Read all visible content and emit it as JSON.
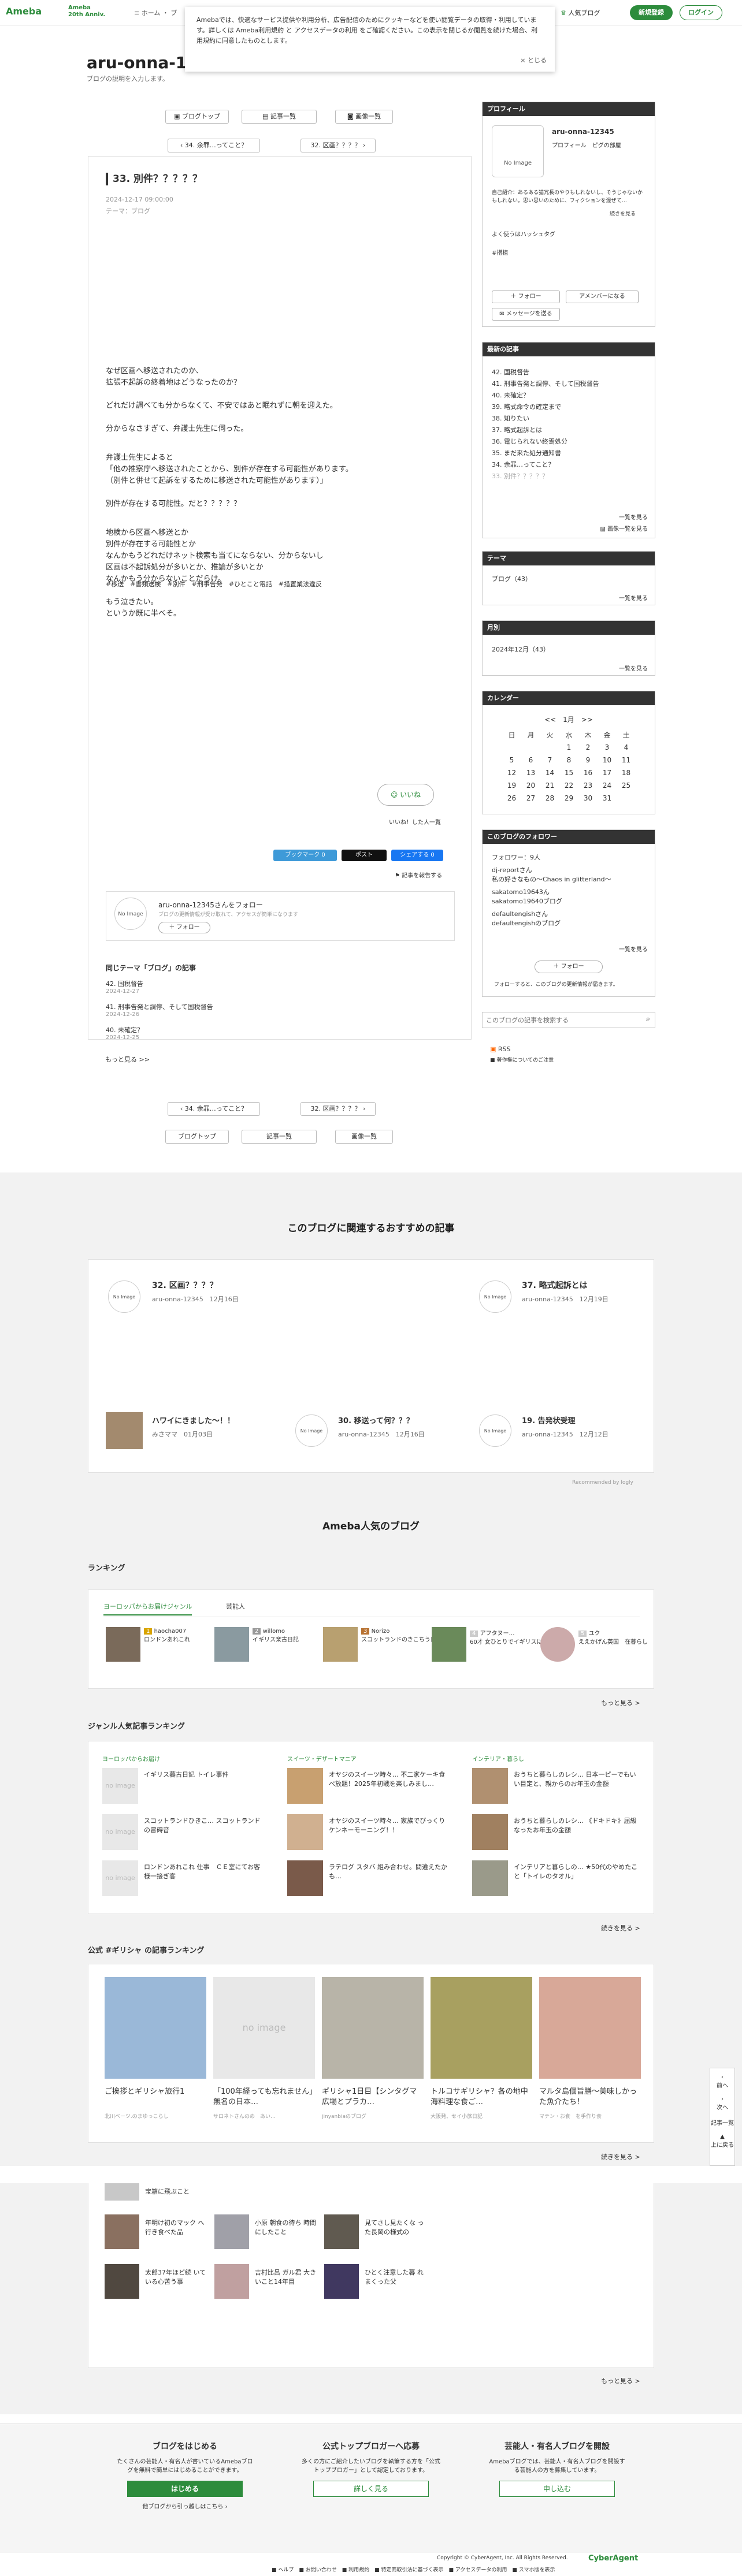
{
  "header": {
    "logo": "Ameba",
    "anniv": "Ameba\n20th Anniv.",
    "nav": "≡ ホーム ・ ブ",
    "popular": "人気ブログ",
    "register": "新規登録",
    "login": "ログイン"
  },
  "cookie": {
    "text": "Amebaでは、快適なサービス提供や利用分析、広告配信のためにクッキーなどを使い閲覧データの取得・利用しています。詳しくは Ameba利用規約 と アクセスデータの利用 をご確認ください。この表示を閉じるか閲覧を続けた場合、利用規約に同意したものとします。",
    "close": "× とじる"
  },
  "blog": {
    "title": "aru-onna-12",
    "desc": "ブログの説明を入力します。"
  },
  "nav": {
    "top": "ブログトップ",
    "list": "記事一覧",
    "images": "画像一覧",
    "prev": "34. 余罪…ってこと？",
    "next": "32. 区画？？？？"
  },
  "article": {
    "title": "33. 別件？？？？？",
    "date": "2024-12-17 09:00:00",
    "theme": "テーマ：ブログ",
    "lines": [
      "なぜ区画へ移送されたのか、",
      "拡張不起訴の終着地はどうなったのか？",
      "どれだけ調べても分からなくて、不安ではあと眠れずに朝を迎えた。",
      "分からなさすぎて、弁護士先生に伺った。",
      "弁護士先生によると",
      "「他の推察庁へ移送されたことから、別件が存在する可能性があります。",
      "（別件と併せて起訴をするために移送された可能性があります）」",
      "別件が存在する可能性。だと？？？？？",
      "地検から区画へ移送とか",
      "別件が存在する可能性とか",
      "なんかもうどれだけネット検索も当てにならない、分からないし",
      "区画は不起訴処分が多いとか、推論が多いとか",
      "なんかもう分からないことだらけ。",
      "もう泣きたい。",
      "というか既に半べそ。"
    ],
    "tags": "#移送　#書類送検　#別件　#刑事告発　#ひとこと電話　#措置業法違反",
    "iine": "いいね",
    "iine_count": "いいね！した人一覧",
    "share1": "ブックマーク 0",
    "share2": "ポスト",
    "share3": "シェアする 0",
    "reblog": "記事を報告する",
    "follow_title": "aru-onna-12345さんをフォロー",
    "follow_sub": "ブログの更新情報が受け取れて、アクセスが簡単になります",
    "follow_btn": "フォロー",
    "same_theme": "同じテーマ「ブログ」の記事",
    "related": [
      {
        "t": "42. 国税督告",
        "d": "2024-12-27"
      },
      {
        "t": "41. 刑事告発と調停、そして国税督告",
        "d": "2024-12-26"
      },
      {
        "t": "40. 未確定？",
        "d": "2024-12-25"
      }
    ],
    "more": "もっと見る >>"
  },
  "profile": {
    "head": "プロフィール",
    "name": "aru-onna-12345",
    "link": "プロフィール　ピグの部屋",
    "bio": "自己紹介：あるある猫冗長のやりもしれないし、そうじゃないかもしれない。思い思いのために、フィクションを混ぜて…",
    "bio_more": "続きを見る",
    "hashtag": "よく使うはハッシュタグ",
    "hashtag2": "#措植",
    "follow": "フォロー",
    "amember": "アメンバーになる",
    "message": "メッセージを送る",
    "noimage": "No Image"
  },
  "recent": {
    "head": "最新の記事",
    "items": [
      "42. 国税督告",
      "41. 刑事告発と調停、そして国税督告",
      "40. 未確定？",
      "39. 略式命令の確定まで",
      "38. 知りたい",
      "37. 略式起訴とは",
      "36. 電じられない終焉処分",
      "35. まだ来た処分通知書",
      "34. 余罪…ってこと？",
      "33. 別件？？？？？"
    ],
    "more1": "一覧を見る",
    "more2": "画像一覧を見る"
  },
  "theme": {
    "head": "テーマ",
    "item": "ブログ（43）",
    "more": "一覧を見る"
  },
  "monthly": {
    "head": "月別",
    "item": "2024年12月（43）",
    "more": "一覧を見る"
  },
  "calendar": {
    "head": "カレンダー",
    "nav": "<<　1月　>>",
    "wd": [
      "日",
      "月",
      "火",
      "水",
      "木",
      "金",
      "土"
    ],
    "rows": [
      [
        "",
        "",
        "",
        "1",
        "2",
        "3",
        "4"
      ],
      [
        "5",
        "6",
        "7",
        "8",
        "9",
        "10",
        "11"
      ],
      [
        "12",
        "13",
        "14",
        "15",
        "16",
        "17",
        "18"
      ],
      [
        "19",
        "20",
        "21",
        "22",
        "23",
        "24",
        "25"
      ],
      [
        "26",
        "27",
        "28",
        "29",
        "30",
        "31",
        ""
      ]
    ]
  },
  "followers": {
    "head": "このブログのフォロワー",
    "count": "フォロワー：9人",
    "items": [
      "dj-reportさん",
      "私の好きなもの〜Chaos in glitterland〜",
      "sakatomo19643ん",
      "sakatomo19640ブログ",
      "defaultengishさん",
      "defaultengishのブログ"
    ],
    "more": "一覧を見る",
    "btn": "フォロー",
    "note": "フォローすると、このブログの更新情報が届きます。"
  },
  "search": {
    "placeholder": "このブログの記事を検索する",
    "rss": "RSS",
    "rss2": "■ 著作権についてのご注意"
  },
  "recommend": {
    "title": "このブログに関連するおすすめの記事",
    "items": [
      {
        "t": "32. 区画？？？？",
        "a": "aru-onna-12345",
        "d": "12月16日"
      },
      {
        "t": "37. 略式起訴とは",
        "a": "aru-onna-12345",
        "d": "12月19日"
      },
      {
        "t": "ハワイにきました〜！！",
        "a": "みさママ",
        "d": "01月03日"
      },
      {
        "t": "30. 移送って何？？？",
        "a": "aru-onna-12345",
        "d": "12月16日"
      },
      {
        "t": "19. 告発状受理",
        "a": "aru-onna-12345",
        "d": "12月12日"
      }
    ],
    "powered": "Recommended by  logly"
  },
  "popular": {
    "title": "Ameba人気のブログ",
    "ranking": "ランキング",
    "tab1": "ヨーロッパからお届けジャンル",
    "tab2": "芸能人",
    "rank": [
      {
        "n": "1",
        "a": "haocha007",
        "t": "ロンドンあれこれ"
      },
      {
        "n": "2",
        "a": "willomo",
        "t": "イギリス楽古日記"
      },
      {
        "n": "3",
        "a": "Norizo",
        "t": "スコットランドのきこちう日記"
      },
      {
        "n": "4",
        "a": "アフタヌー…",
        "t": "60才 女ひとりでイギリスに移住"
      },
      {
        "n": "5",
        "a": "ユク",
        "t": "ええかげん英国　在暮らし"
      }
    ],
    "more": "もっと見る >",
    "genre_title": "ジャンル人気記事ランキング",
    "g1h": "ヨーロッパからお届け",
    "g2h": "スイーツ・デザートマニア",
    "g3h": "インテリア・暮らし",
    "g1": [
      "イギリス暮古日記 トイレ事件",
      "スコットランドひきこ… スコットランドの冒碍音",
      "ロンドンあれこれ 仕事　ＣＥ室にてお客様一接ぎ客"
    ],
    "g2": [
      "オヤジのスイーツ時々… 不二家ケーキ食べ放題！2025年初戦を楽しみまし…",
      "オヤジのスイーツ時々… 家族でびっくりケンネーモーニング！！",
      "ラテログ スタバ 組み合わせ。間違えたかも…"
    ],
    "g3": [
      "おうちと暮らしのレシ… 日本一ピーでもいい目定と、親からのお年玉の金額",
      "おうちと暮らしのレシ… 《ドキドキ》届級なったお年玉の金額",
      "インテリアと暮らしの… ★50代のやめたこと「トイレのタオル」"
    ],
    "cont": "続きを見る >",
    "official": "公式 #ギリシャ の記事ランキング",
    "off": [
      {
        "t": "ご挨拶とギリシャ旅行1",
        "a": "北川ベーツ.のまゆっこらし"
      },
      {
        "t": "「100年経っても忘れません」無名の日本…",
        "a": "サロネトさんのめ　あい…"
      },
      {
        "t": "ギリシャ1日目【シンタグマ広場とプラカ…",
        "a": "jinyanbiaのブログ"
      },
      {
        "t": "トルコサギリシャ？各の地中海料理な食ご…",
        "a": "大阪発、セイ小旅日記"
      },
      {
        "t": "マルタ島個旨膳〜美味しかった魚介たち！",
        "a": "マテン・お食　を手作り食"
      }
    ],
    "cont2": "続きを見る >",
    "grid": [
      "宝箱に飛ぶこと",
      "年明け初のマック へ行き食べた品",
      "小原 朝食の待ち 時間にしたこと",
      "見てさし見たくな った長岡の様式の",
      "太郎37年ほど続 いている心苦う事",
      "吉村比呂 ガル君 大きいこと14年目",
      "ひとく注意した暮 れまくった父"
    ],
    "more2": "もっと見る >"
  },
  "footer": {
    "c1t": "ブログをはじめる",
    "c1d": "たくさんの芸能人・有名人が書いているAmebaブログを無料で簡単にはじめることができます。",
    "c1b": "はじめる",
    "c1l": "他ブログから引っ越しはこちら ›",
    "c2t": "公式トップブロガーへ応募",
    "c2d": "多くの方にご紹介したいブログを執筆する方を「公式トップブロガー」として認定しております。",
    "c2b": "詳しく見る",
    "c3t": "芸能人・有名人ブログを開設",
    "c3d": "Amebaブログでは、芸能人・有名人ブログを開設する芸能人の方を募集しています。",
    "c3b": "申し込む",
    "copy": "Copyright © CyberAgent, Inc. All Rights Reserved.",
    "brand": "CyberAgent",
    "links": "■ ヘルプ　■ お問い合わせ　■ 利用規約　■ 特定商取引法に基づく表示　■ アクセスデータの利用　■ スマホ版を表示"
  },
  "floatnav": {
    "a": "前へ",
    "b": "次へ",
    "c": "記事一覧",
    "d": "上に戻る"
  },
  "colors": {
    "accent": "#2d8c3c"
  }
}
